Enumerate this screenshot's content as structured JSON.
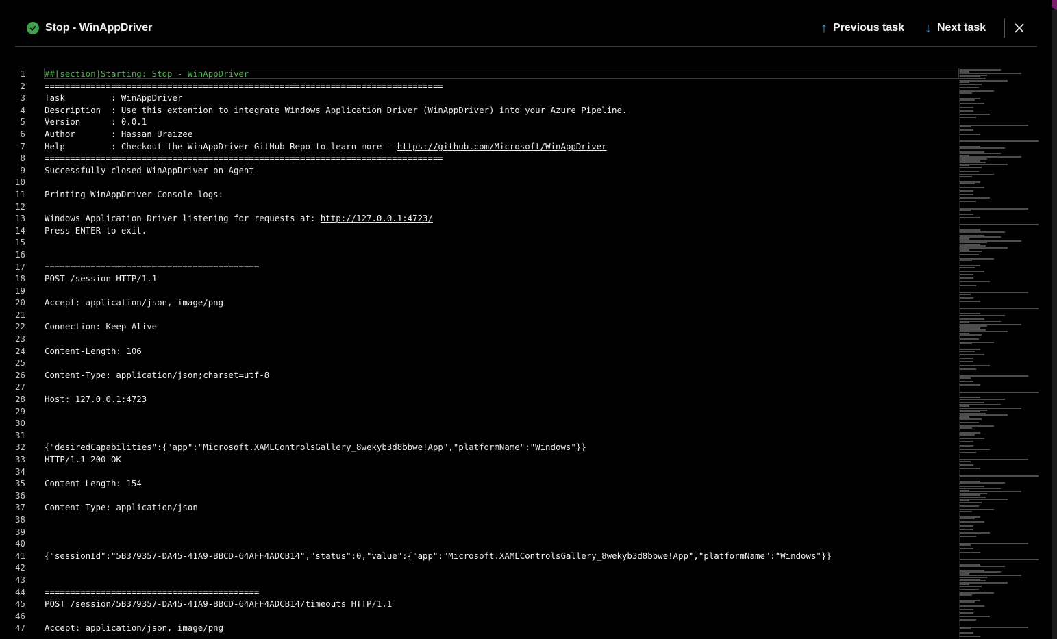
{
  "header": {
    "status_icon": "check-circle-icon",
    "status_color": "#3fa34d",
    "title": "Stop - WinAppDriver",
    "previous_label": "Previous task",
    "next_label": "Next task",
    "previous_icon": "arrow-up-icon",
    "next_icon": "arrow-down-icon",
    "close_icon": "close-icon"
  },
  "log": {
    "lines": [
      {
        "n": "1",
        "t": "##[section]Starting: Stop - WinAppDriver",
        "kind": "section"
      },
      {
        "n": "2",
        "t": "=============================================================================="
      },
      {
        "n": "3",
        "t": "Task         : WinAppDriver"
      },
      {
        "n": "4",
        "t": "Description  : Use this extention to integrate Windows Application Driver (WinAppDriver) into your Azure Pipeline."
      },
      {
        "n": "5",
        "t": "Version      : 0.0.1"
      },
      {
        "n": "6",
        "t": "Author       : Hassan Uraizee"
      },
      {
        "n": "7",
        "t": "Help         : Checkout the WinAppDriver GitHub Repo to learn more - ",
        "link": "https://github.com/Microsoft/WinAppDriver"
      },
      {
        "n": "8",
        "t": "=============================================================================="
      },
      {
        "n": "9",
        "t": "Successfully closed WinAppDriver on Agent"
      },
      {
        "n": "10",
        "t": ""
      },
      {
        "n": "11",
        "t": "Printing WinAppDriver Console logs:"
      },
      {
        "n": "12",
        "t": ""
      },
      {
        "n": "13",
        "t": "Windows Application Driver listening for requests at: ",
        "link": "http://127.0.0.1:4723/"
      },
      {
        "n": "14",
        "t": "Press ENTER to exit."
      },
      {
        "n": "15",
        "t": ""
      },
      {
        "n": "16",
        "t": ""
      },
      {
        "n": "17",
        "t": "=========================================="
      },
      {
        "n": "18",
        "t": "POST /session HTTP/1.1"
      },
      {
        "n": "19",
        "t": ""
      },
      {
        "n": "20",
        "t": "Accept: application/json, image/png"
      },
      {
        "n": "21",
        "t": ""
      },
      {
        "n": "22",
        "t": "Connection: Keep-Alive"
      },
      {
        "n": "23",
        "t": ""
      },
      {
        "n": "24",
        "t": "Content-Length: 106"
      },
      {
        "n": "25",
        "t": ""
      },
      {
        "n": "26",
        "t": "Content-Type: application/json;charset=utf-8"
      },
      {
        "n": "27",
        "t": ""
      },
      {
        "n": "28",
        "t": "Host: 127.0.0.1:4723"
      },
      {
        "n": "29",
        "t": ""
      },
      {
        "n": "30",
        "t": ""
      },
      {
        "n": "31",
        "t": ""
      },
      {
        "n": "32",
        "t": "{\"desiredCapabilities\":{\"app\":\"Microsoft.XAMLControlsGallery_8wekyb3d8bbwe!App\",\"platformName\":\"Windows\"}}"
      },
      {
        "n": "33",
        "t": "HTTP/1.1 200 OK"
      },
      {
        "n": "34",
        "t": ""
      },
      {
        "n": "35",
        "t": "Content-Length: 154"
      },
      {
        "n": "36",
        "t": ""
      },
      {
        "n": "37",
        "t": "Content-Type: application/json"
      },
      {
        "n": "38",
        "t": ""
      },
      {
        "n": "39",
        "t": ""
      },
      {
        "n": "40",
        "t": ""
      },
      {
        "n": "41",
        "t": "{\"sessionId\":\"5B379357-DA45-41A9-BBCD-64AFF4ADCB14\",\"status\":0,\"value\":{\"app\":\"Microsoft.XAMLControlsGallery_8wekyb3d8bbwe!App\",\"platformName\":\"Windows\"}}"
      },
      {
        "n": "42",
        "t": ""
      },
      {
        "n": "43",
        "t": ""
      },
      {
        "n": "44",
        "t": "=========================================="
      },
      {
        "n": "45",
        "t": "POST /session/5B379357-DA45-41A9-BBCD-64AFF4ADCB14/timeouts HTTP/1.1"
      },
      {
        "n": "46",
        "t": ""
      },
      {
        "n": "47",
        "t": "Accept: application/json, image/png"
      }
    ]
  },
  "colors": {
    "background": "#000000",
    "accent": "#4c9bd8",
    "section_text": "#4cb04c"
  }
}
